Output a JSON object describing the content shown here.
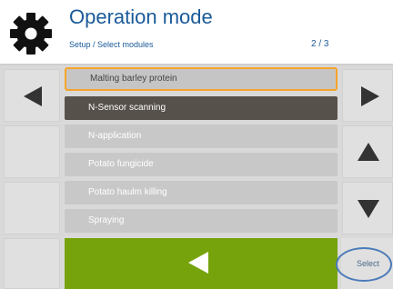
{
  "header": {
    "title": "Operation mode",
    "breadcrumb": "Setup / Select modules",
    "page_indicator": "2 / 3",
    "icon": "gear-icon"
  },
  "list": {
    "items": [
      {
        "label": "Malting barley protein",
        "state": "focused"
      },
      {
        "label": "N-Sensor scanning",
        "state": "active"
      },
      {
        "label": "N-application",
        "state": "normal"
      },
      {
        "label": "Potato fungicide",
        "state": "normal"
      },
      {
        "label": "Potato haulm killing",
        "state": "normal"
      },
      {
        "label": "Spraying",
        "state": "normal"
      }
    ]
  },
  "buttons": {
    "prev_page": "arrow-left-icon",
    "next_page": "arrow-right-icon",
    "scroll_up": "arrow-up-icon",
    "scroll_down": "arrow-down-icon",
    "back": "back-arrow-icon",
    "select_label": "Select"
  },
  "colors": {
    "title": "#1a5a99",
    "focus_border": "#f5a428",
    "active_item": "#57514b",
    "back_button": "#76a30b",
    "highlight_ring": "#4a7ab8"
  }
}
